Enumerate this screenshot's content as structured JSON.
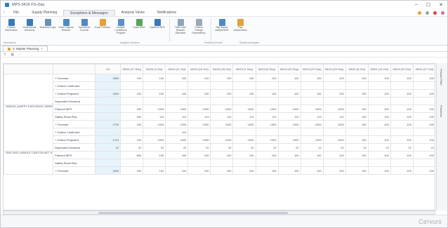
{
  "window": {
    "title": "MPS 0416 FG-Day"
  },
  "menu": {
    "items": [
      "File",
      "Supply Planning",
      "Exceptions & Messages",
      "Analysis Views",
      "Notifications"
    ],
    "active_index": 2
  },
  "ribbon": {
    "buttons": [
      {
        "label": "Custom Dimensions",
        "color": "#3a78b8"
      },
      {
        "label": "Dimensional Hierarchy",
        "color": "#3a78b8"
      },
      {
        "label": "Business Logic",
        "color": "#6a8fb6"
      },
      {
        "label": "Order Capture Network",
        "color": "#4f88c6"
      },
      {
        "label": "Operations Console",
        "color": "#4f88c6"
      },
      {
        "label": "Excel Function",
        "color": "#e3a13b"
      },
      {
        "label": "Analyze Confidence Program",
        "color": "#5b90c8"
      },
      {
        "label": "Scale RMS",
        "color": "#5ba35b"
      },
      {
        "label": "Optimize MPS",
        "color": "#3a78b8"
      },
      {
        "label": "Shift Lead Network Allocation",
        "color": "#8da6c0"
      },
      {
        "label": "Custom Change Dependency",
        "color": "#9aa8b8"
      },
      {
        "label": "Mfg Supply Independent",
        "color": "#4f88c6"
      },
      {
        "label": "Play Independent",
        "color": "#e3a13b"
      }
    ],
    "group_labels": [
      "Dimensions",
      "Analytics Services",
      "Preferred Events",
      "Statistical Analysis"
    ]
  },
  "tabs": [
    {
      "label": "2. Master Planning"
    }
  ],
  "grid": {
    "columns": [
      "",
      "",
      "On",
      "06/24 (27 Sep)",
      "06/24 (4 Oct)",
      "06/24 (11 Oct)",
      "06/24 (18 Oct)",
      "06/24 (25 Oct)",
      "06/24 (1 Sep)",
      "06/24 (8 Sep)",
      "06/24 (15 Sep)",
      "06/24 (22 Sep)",
      "06/24 (29 Sep)",
      "06/24 (6 Oct)",
      "06/24 (13 Oct)",
      "06/24 (20 Oct)",
      "06/24 (27 Oct)"
    ],
    "groups": [
      {
        "product": "",
        "rows": [
          {
            "measure": "+ Forecast",
            "values": [
              "1800",
              "100",
              "100",
              "100",
              "100",
              "100",
              "100",
              "100",
              "100",
              "100",
              "100",
              "100",
              "100",
              "100",
              "100"
            ]
          },
          {
            "measure": "+ Orders Confirmed",
            "values": [
              "",
              "",
              "",
              "",
              "",
              "",
              "",
              "",
              "",
              "",
              "",
              "",
              "",
              "",
              ""
            ]
          },
          {
            "measure": "+ Orders Projected",
            "values": [
              "1800",
              "100",
              "100",
              "100",
              "100",
              "100",
              "100",
              "100",
              "100",
              "100",
              "100",
              "100",
              "100",
              "100",
              "100"
            ]
          },
          {
            "measure": "Dependent Demand",
            "values": [
              "",
              "",
              "",
              "",
              "",
              "",
              "",
              "",
              "",
              "",
              "",
              "",
              "",
              "",
              ""
            ]
          }
        ]
      },
      {
        "product": "GN0001 (HAPPY KIDS BOOK SERIES)",
        "rows": [
          {
            "measure": "Planned MPS",
            "values": [
              "",
              "320",
              "1000",
              "1000",
              "1000",
              "1000",
              "1000",
              "1000",
              "1000",
              "1000",
              "1000",
              "100",
              "100",
              "100",
              "100"
            ]
          },
          {
            "measure": "Safety Stock Plan",
            "values": [
              "",
              "320",
              "113",
              "113",
              "113",
              "113",
              "113",
              "113",
              "113",
              "113",
              "113",
              "100",
              "100",
              "100",
              "100"
            ]
          },
          {
            "measure": "+ Forecast",
            "values": [
              "1700",
              "100",
              "1000",
              "1000",
              "1000",
              "1000",
              "1000",
              "1000",
              "1000",
              "1000",
              "1000",
              "100",
              "100",
              "100",
              "100"
            ]
          },
          {
            "measure": "+ Orders Confirmed",
            "values": [
              "",
              "",
              "",
              "113",
              "",
              "",
              "",
              "",
              "",
              "",
              "",
              "",
              "",
              "",
              ""
            ]
          },
          {
            "measure": "+ Orders Projected",
            "values": [
              "1731",
              "100",
              "1000",
              "1000",
              "1000",
              "1000",
              "1000",
              "1000",
              "1000",
              "1000",
              "1000",
              "100",
              "100",
              "100",
              "100"
            ]
          },
          {
            "measure": "Dependent Demand",
            "values": [
              "22",
              "22",
              "22",
              "22",
              "22",
              "22",
              "22",
              "22",
              "22",
              "22",
              "22",
              "22",
              "22",
              "22",
              "22"
            ]
          }
        ]
      },
      {
        "product": "GNS-0001 (SINGLE CARTON ADT 5 KIDS)",
        "rows": [
          {
            "measure": "Planned MPS",
            "values": [
              "",
              "800",
              "100",
              "100",
              "100",
              "100",
              "100",
              "100",
              "100",
              "100",
              "100",
              "100",
              "100",
              "100",
              "100"
            ]
          },
          {
            "measure": "Safety Stock Plan",
            "values": [
              "",
              "",
              "",
              "",
              "",
              "",
              "",
              "",
              "",
              "",
              "",
              "",
              "",
              "",
              ""
            ]
          },
          {
            "measure": "+ Forecast",
            "values": [
              "1800",
              "100",
              "100",
              "100",
              "100",
              "100",
              "100",
              "100",
              "100",
              "100",
              "100",
              "100",
              "100",
              "100",
              "100"
            ]
          }
        ]
      }
    ]
  },
  "side_tabs": [
    "Product Filter",
    "Problems"
  ],
  "logo": {
    "text": "Cervurs"
  }
}
